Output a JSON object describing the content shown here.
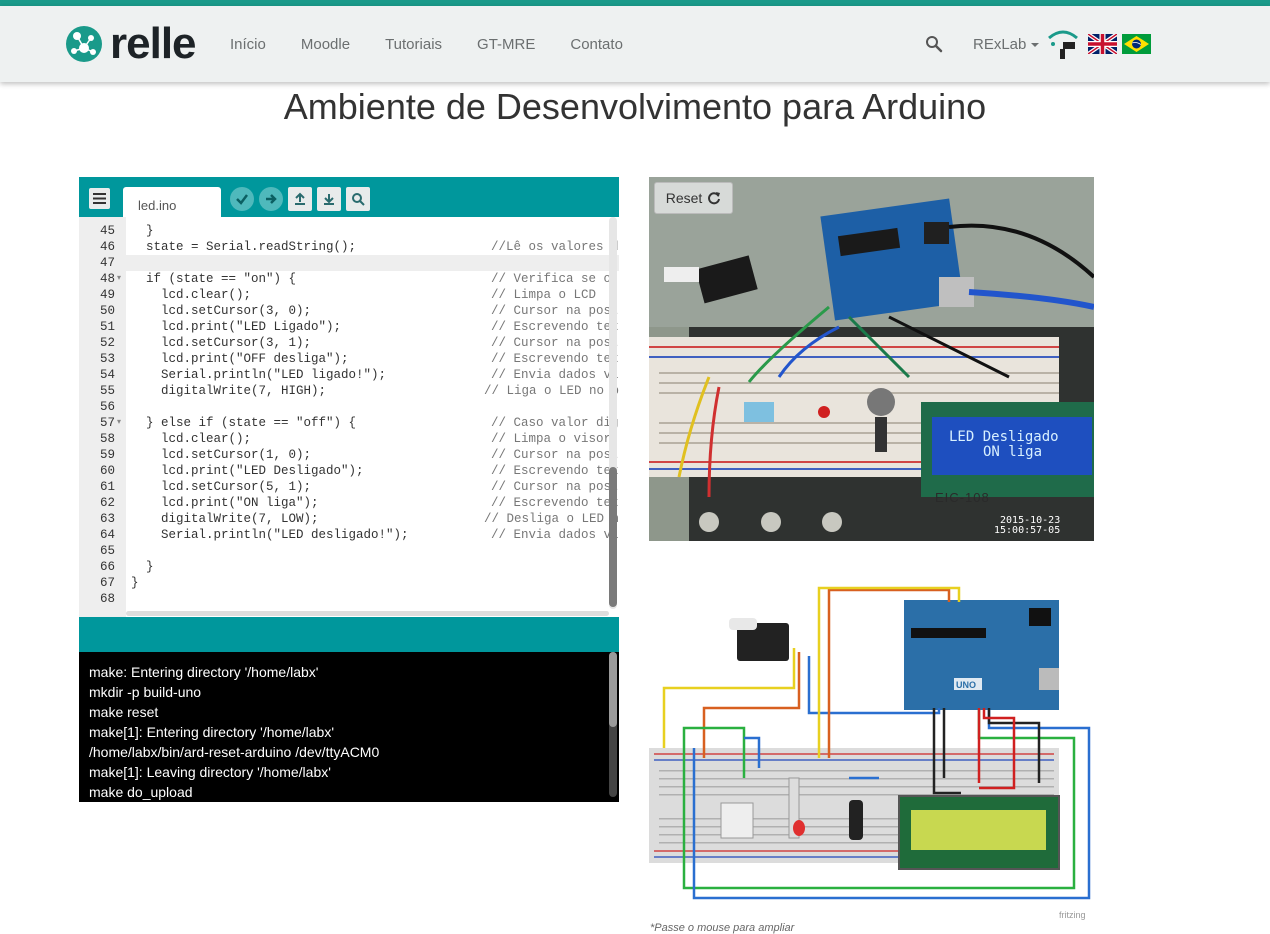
{
  "navbar": {
    "logo_text": "relle",
    "links": [
      "Início",
      "Moodle",
      "Tutoriais",
      "GT-MRE",
      "Contato"
    ],
    "lab_menu": "RExLab"
  },
  "page": {
    "title": "Ambiente de Desenvolvimento para Arduino"
  },
  "editor": {
    "tab_label": "led.ino",
    "toolbar_icons": [
      "menu-icon",
      "verify-icon",
      "upload-icon",
      "upload-file-icon",
      "download-file-icon",
      "search-icon"
    ],
    "lines": [
      {
        "n": "45",
        "code": "  }",
        "comment": ""
      },
      {
        "n": "46",
        "code": "  state = Serial.readString();",
        "comment": "//Lê os valores d"
      },
      {
        "n": "47",
        "code": "",
        "comment": ""
      },
      {
        "n": "48",
        "code": "  if (state == \"on\") {",
        "comment": "// Verifica se o"
      },
      {
        "n": "49",
        "code": "    lcd.clear();",
        "comment": "// Limpa o LCD"
      },
      {
        "n": "50",
        "code": "    lcd.setCursor(3, 0);",
        "comment": "// Cursor na post"
      },
      {
        "n": "51",
        "code": "    lcd.print(\"LED Ligado\");",
        "comment": "// Escrevendo tex"
      },
      {
        "n": "52",
        "code": "    lcd.setCursor(3, 1);",
        "comment": "// Cursor na post"
      },
      {
        "n": "53",
        "code": "    lcd.print(\"OFF desliga\");",
        "comment": "// Escrevendo tex"
      },
      {
        "n": "54",
        "code": "    Serial.println(\"LED ligado!\");",
        "comment": "// Envia dados vi"
      },
      {
        "n": "55",
        "code": "    digitalWrite(7, HIGH);",
        "comment": "// Liga o LED no p"
      },
      {
        "n": "56",
        "code": "",
        "comment": ""
      },
      {
        "n": "57",
        "code": "  } else if (state == \"off\") {",
        "comment": "// Caso valor dig"
      },
      {
        "n": "58",
        "code": "    lcd.clear();",
        "comment": "// Limpa o visor"
      },
      {
        "n": "59",
        "code": "    lcd.setCursor(1, 0);",
        "comment": "// Cursor na post"
      },
      {
        "n": "60",
        "code": "    lcd.print(\"LED Desligado\");",
        "comment": "// Escrevendo tex"
      },
      {
        "n": "61",
        "code": "    lcd.setCursor(5, 1);",
        "comment": "// Cursor na post"
      },
      {
        "n": "62",
        "code": "    lcd.print(\"ON liga\");",
        "comment": "// Escrevendo tex"
      },
      {
        "n": "63",
        "code": "    digitalWrite(7, LOW);",
        "comment": "// Desliga o LED n"
      },
      {
        "n": "64",
        "code": "    Serial.println(\"LED desligado!\");",
        "comment": "// Envia dados vi"
      },
      {
        "n": "65",
        "code": "",
        "comment": ""
      },
      {
        "n": "66",
        "code": "  }",
        "comment": ""
      },
      {
        "n": "67",
        "code": "}",
        "comment": ""
      },
      {
        "n": "68",
        "code": "",
        "comment": ""
      }
    ]
  },
  "console": {
    "lines": [
      "make: Entering directory '/home/labx'",
      "mkdir -p build-uno",
      "make reset",
      "make[1]: Entering directory '/home/labx'",
      "/home/labx/bin/ard-reset-arduino /dev/ttyACM0",
      "make[1]: Leaving directory '/home/labx'",
      "make do_upload"
    ]
  },
  "camera": {
    "reset_label": "Reset",
    "lcd_line1": "LED Desligado",
    "lcd_line2": "ON liga",
    "timestamp_date": "2015-10-23",
    "timestamp_time": "15:00:57-05",
    "board_label": "EIC-108"
  },
  "schematic": {
    "watermark": "fritzing",
    "board_text": "UNO"
  },
  "footnote": "*Passe o mouse para ampliar"
}
